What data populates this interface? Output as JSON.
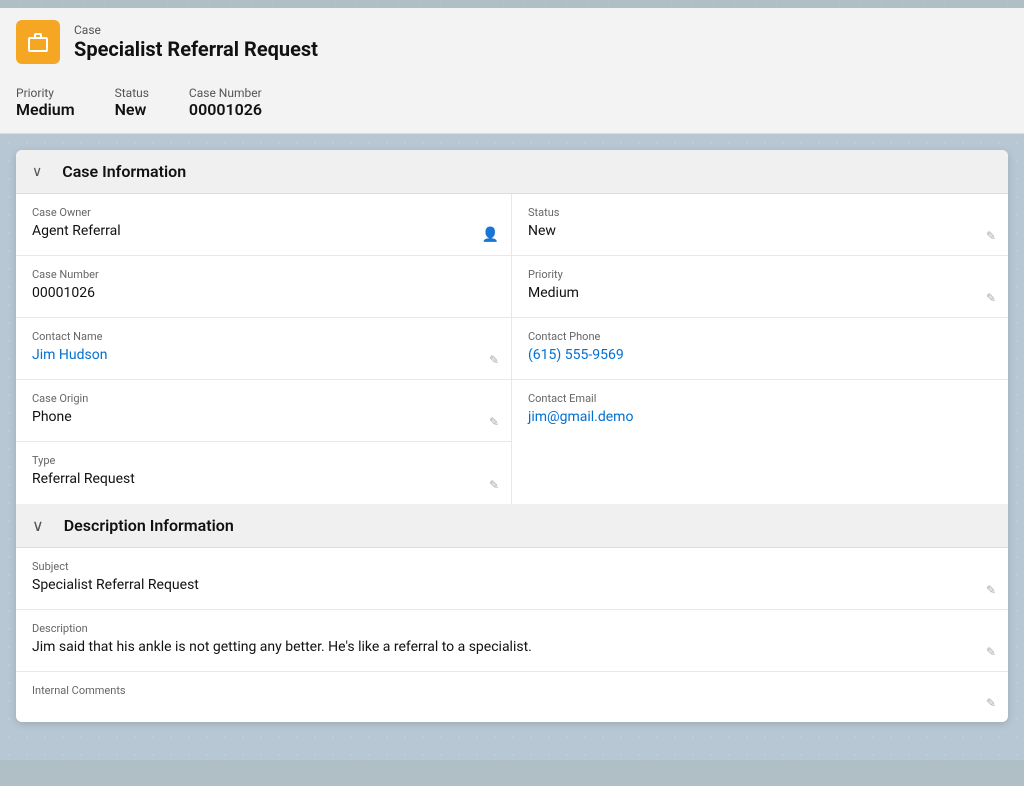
{
  "topBar": {},
  "header": {
    "caseLabel": "Case",
    "title": "Specialist Referral Request",
    "priority": {
      "label": "Priority",
      "value": "Medium"
    },
    "status": {
      "label": "Status",
      "value": "New"
    },
    "caseNumber": {
      "label": "Case Number",
      "value": "00001026"
    }
  },
  "caseInfoSection": {
    "title": "Case Information",
    "fields": {
      "caseOwnerLabel": "Case Owner",
      "caseOwnerValue": "Agent Referral",
      "statusLabel": "Status",
      "statusValue": "New",
      "caseNumberLabel": "Case Number",
      "caseNumberValue": "00001026",
      "priorityLabel": "Priority",
      "priorityValue": "Medium",
      "contactNameLabel": "Contact Name",
      "contactNameValue": "Jim Hudson",
      "contactPhoneLabel": "Contact Phone",
      "contactPhoneValue": "(615) 555-9569",
      "caseOriginLabel": "Case Origin",
      "caseOriginValue": "Phone",
      "contactEmailLabel": "Contact Email",
      "contactEmailValue": "jim@gmail.demo",
      "typeLabel": "Type",
      "typeValue": "Referral Request"
    }
  },
  "descriptionSection": {
    "title": "Description Information",
    "fields": {
      "subjectLabel": "Subject",
      "subjectValue": "Specialist Referral Request",
      "descriptionLabel": "Description",
      "descriptionValue": "Jim said that his ankle is not getting any better. He's like a referral to a specialist.",
      "internalCommentsLabel": "Internal Comments",
      "internalCommentsValue": ""
    }
  },
  "icons": {
    "chevron": "❯",
    "pencil": "✏",
    "person": "👤"
  }
}
